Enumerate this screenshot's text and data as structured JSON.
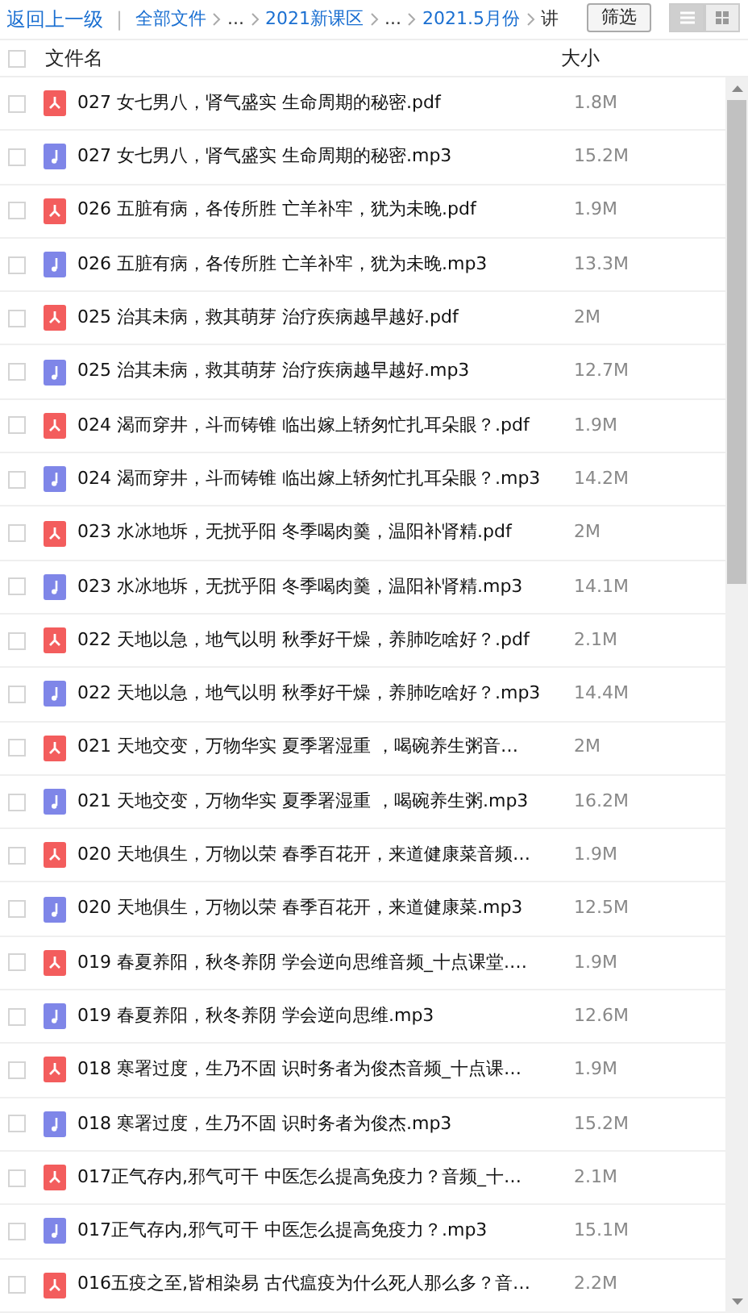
{
  "breadcrumb": {
    "back": "返回上一级",
    "separator": "|",
    "items": [
      {
        "label": "全部文件",
        "link": true
      },
      {
        "label": "...",
        "link": false
      },
      {
        "label": "2021新课区",
        "link": true
      },
      {
        "label": "...",
        "link": false
      },
      {
        "label": "2021.5月份",
        "link": true
      },
      {
        "label": "讲",
        "link": false
      }
    ],
    "filter_button": "筛选",
    "view_modes": [
      {
        "kind": "list",
        "selected": true
      },
      {
        "kind": "grid",
        "selected": false
      }
    ]
  },
  "table": {
    "select_all_checked": false,
    "columns": [
      "文件名",
      "大小"
    ],
    "rows": [
      {
        "kind": "pdf",
        "name": "027 女七男八，肾气盛实 生命周期的秘密.pdf",
        "size": "1.8M",
        "checked": false
      },
      {
        "kind": "mp3",
        "name": "027 女七男八，肾气盛实 生命周期的秘密.mp3",
        "size": "15.2M",
        "checked": false
      },
      {
        "kind": "pdf",
        "name": "026 五脏有病，各传所胜 亡羊补牢，犹为未晚.pdf",
        "size": "1.9M",
        "checked": false
      },
      {
        "kind": "mp3",
        "name": "026 五脏有病，各传所胜 亡羊补牢，犹为未晚.mp3",
        "size": "13.3M",
        "checked": false
      },
      {
        "kind": "pdf",
        "name": "025 治其未病，救其萌芽 治疗疾病越早越好.pdf",
        "size": "2M",
        "checked": false
      },
      {
        "kind": "mp3",
        "name": "025 治其未病，救其萌芽 治疗疾病越早越好.mp3",
        "size": "12.7M",
        "checked": false
      },
      {
        "kind": "pdf",
        "name": "024 渴而穿井，斗而铸锥 临出嫁上轿匆忙扎耳朵眼？.pdf",
        "size": "1.9M",
        "checked": false
      },
      {
        "kind": "mp3",
        "name": "024 渴而穿井，斗而铸锥 临出嫁上轿匆忙扎耳朵眼？.mp3",
        "size": "14.2M",
        "checked": false
      },
      {
        "kind": "pdf",
        "name": "023 水冰地坼，无扰乎阳 冬季喝肉羹，温阳补肾精.pdf",
        "size": "2M",
        "checked": false
      },
      {
        "kind": "mp3",
        "name": "023 水冰地坼，无扰乎阳 冬季喝肉羹，温阳补肾精.mp3",
        "size": "14.1M",
        "checked": false
      },
      {
        "kind": "pdf",
        "name": "022 天地以急，地气以明 秋季好干燥，养肺吃啥好？.pdf",
        "size": "2.1M",
        "checked": false
      },
      {
        "kind": "mp3",
        "name": "022 天地以急，地气以明 秋季好干燥，养肺吃啥好？.mp3",
        "size": "14.4M",
        "checked": false
      },
      {
        "kind": "pdf",
        "name": "021 天地交变，万物华实 夏季署湿重 ，喝碗养生粥音…",
        "size": "2M",
        "checked": false
      },
      {
        "kind": "mp3",
        "name": "021 天地交变，万物华实 夏季署湿重 ，喝碗养生粥.mp3",
        "size": "16.2M",
        "checked": false
      },
      {
        "kind": "pdf",
        "name": "020 天地俱生，万物以荣 春季百花开，来道健康菜音频…",
        "size": "1.9M",
        "checked": false
      },
      {
        "kind": "mp3",
        "name": "020 天地俱生，万物以荣 春季百花开，来道健康菜.mp3",
        "size": "12.5M",
        "checked": false
      },
      {
        "kind": "pdf",
        "name": "019 春夏养阳，秋冬养阴 学会逆向思维音频_十点课堂.…",
        "size": "1.9M",
        "checked": false
      },
      {
        "kind": "mp3",
        "name": "019 春夏养阳，秋冬养阴 学会逆向思维.mp3",
        "size": "12.6M",
        "checked": false
      },
      {
        "kind": "pdf",
        "name": "018 寒署过度，生乃不固 识时务者为俊杰音频_十点课…",
        "size": "1.9M",
        "checked": false
      },
      {
        "kind": "mp3",
        "name": "018 寒署过度，生乃不固 识时务者为俊杰.mp3",
        "size": "15.2M",
        "checked": false
      },
      {
        "kind": "pdf",
        "name": "017正气存内,邪气可干 中医怎么提高免疫力？音频_十…",
        "size": "2.1M",
        "checked": false
      },
      {
        "kind": "mp3",
        "name": "017正气存内,邪气可干 中医怎么提高免疫力？.mp3",
        "size": "15.1M",
        "checked": false
      },
      {
        "kind": "pdf",
        "name": "016五疫之至,皆相染易 古代瘟疫为什么死人那么多？音…",
        "size": "2.2M",
        "checked": false
      }
    ]
  }
}
